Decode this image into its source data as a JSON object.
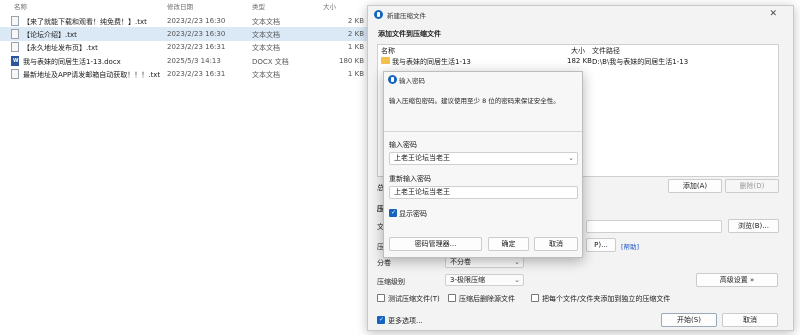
{
  "explorer": {
    "columns": {
      "name": "名称",
      "date": "修改日期",
      "type": "类型",
      "size": "大小"
    },
    "files": [
      {
        "name": "【来了就能下载和观看！纯免费！】.txt",
        "date": "2023/2/23 16:30",
        "type": "文本文档",
        "size": "2 KB",
        "icon": "txt-file-icon",
        "selected": false
      },
      {
        "name": "【论坛介绍】.txt",
        "date": "2023/2/23 16:30",
        "type": "文本文档",
        "size": "2 KB",
        "icon": "txt-file-icon",
        "selected": true
      },
      {
        "name": "【永久地址发布页】.txt",
        "date": "2023/2/23 16:31",
        "type": "文本文档",
        "size": "1 KB",
        "icon": "txt-file-icon",
        "selected": false
      },
      {
        "name": "我与表妹的同居生活1-13.docx",
        "date": "2025/5/3 14:13",
        "type": "DOCX 文档",
        "size": "180 KB",
        "icon": "docx-file-icon",
        "selected": false
      },
      {
        "name": "最新地址及APP请发邮箱自动获取！！！.txt",
        "date": "2023/2/23 16:31",
        "type": "文本文档",
        "size": "1 KB",
        "icon": "txt-file-icon",
        "selected": false
      }
    ]
  },
  "archive_dialog": {
    "title": "新建压缩文件",
    "close": "✕",
    "add_section": "添加文件到压缩文件",
    "list_headers": {
      "name": "名称",
      "size": "大小",
      "path": "文件路径"
    },
    "list_items": [
      {
        "name": "我与表妹的同居生活1-13",
        "size": "182 KB",
        "path": "D:\\B\\我与表妹的同居生活1-13"
      }
    ],
    "partial_labels": {
      "left1": "总",
      "left2": "压",
      "left3": "文",
      "left4": "压"
    },
    "add_button": "添加(A)",
    "delete_button": "删除(D)",
    "browse_button": "浏览(B)...",
    "p_button": "P)...",
    "help_link": "[帮助]",
    "volume_label": "分卷",
    "volume_value": "不分卷",
    "level_label": "压缩级别",
    "level_value": "3-极限压缩",
    "advanced_button": "高级设置 »",
    "test_check": "测试压缩文件(T)",
    "delete_after_check": "压缩后删除源文件",
    "separate_check": "把每个文件/文件夹添加到独立的压缩文件",
    "more_options": "更多选项...",
    "start_button": "开始(S)",
    "cancel_button": "取消"
  },
  "password_dialog": {
    "title": "输入密码",
    "close": "✕",
    "hint": "输入压缩包密码。建议使用至少 8 位的密码来保证安全性。",
    "enter_label": "输入密码",
    "enter_value": "上老王论坛当老王",
    "reenter_label": "重新输入密码",
    "reenter_value": "上老王论坛当老王",
    "show_password": "显示密码",
    "manager_button": "密码管理器...",
    "ok_button": "确定",
    "cancel_button": "取消"
  }
}
